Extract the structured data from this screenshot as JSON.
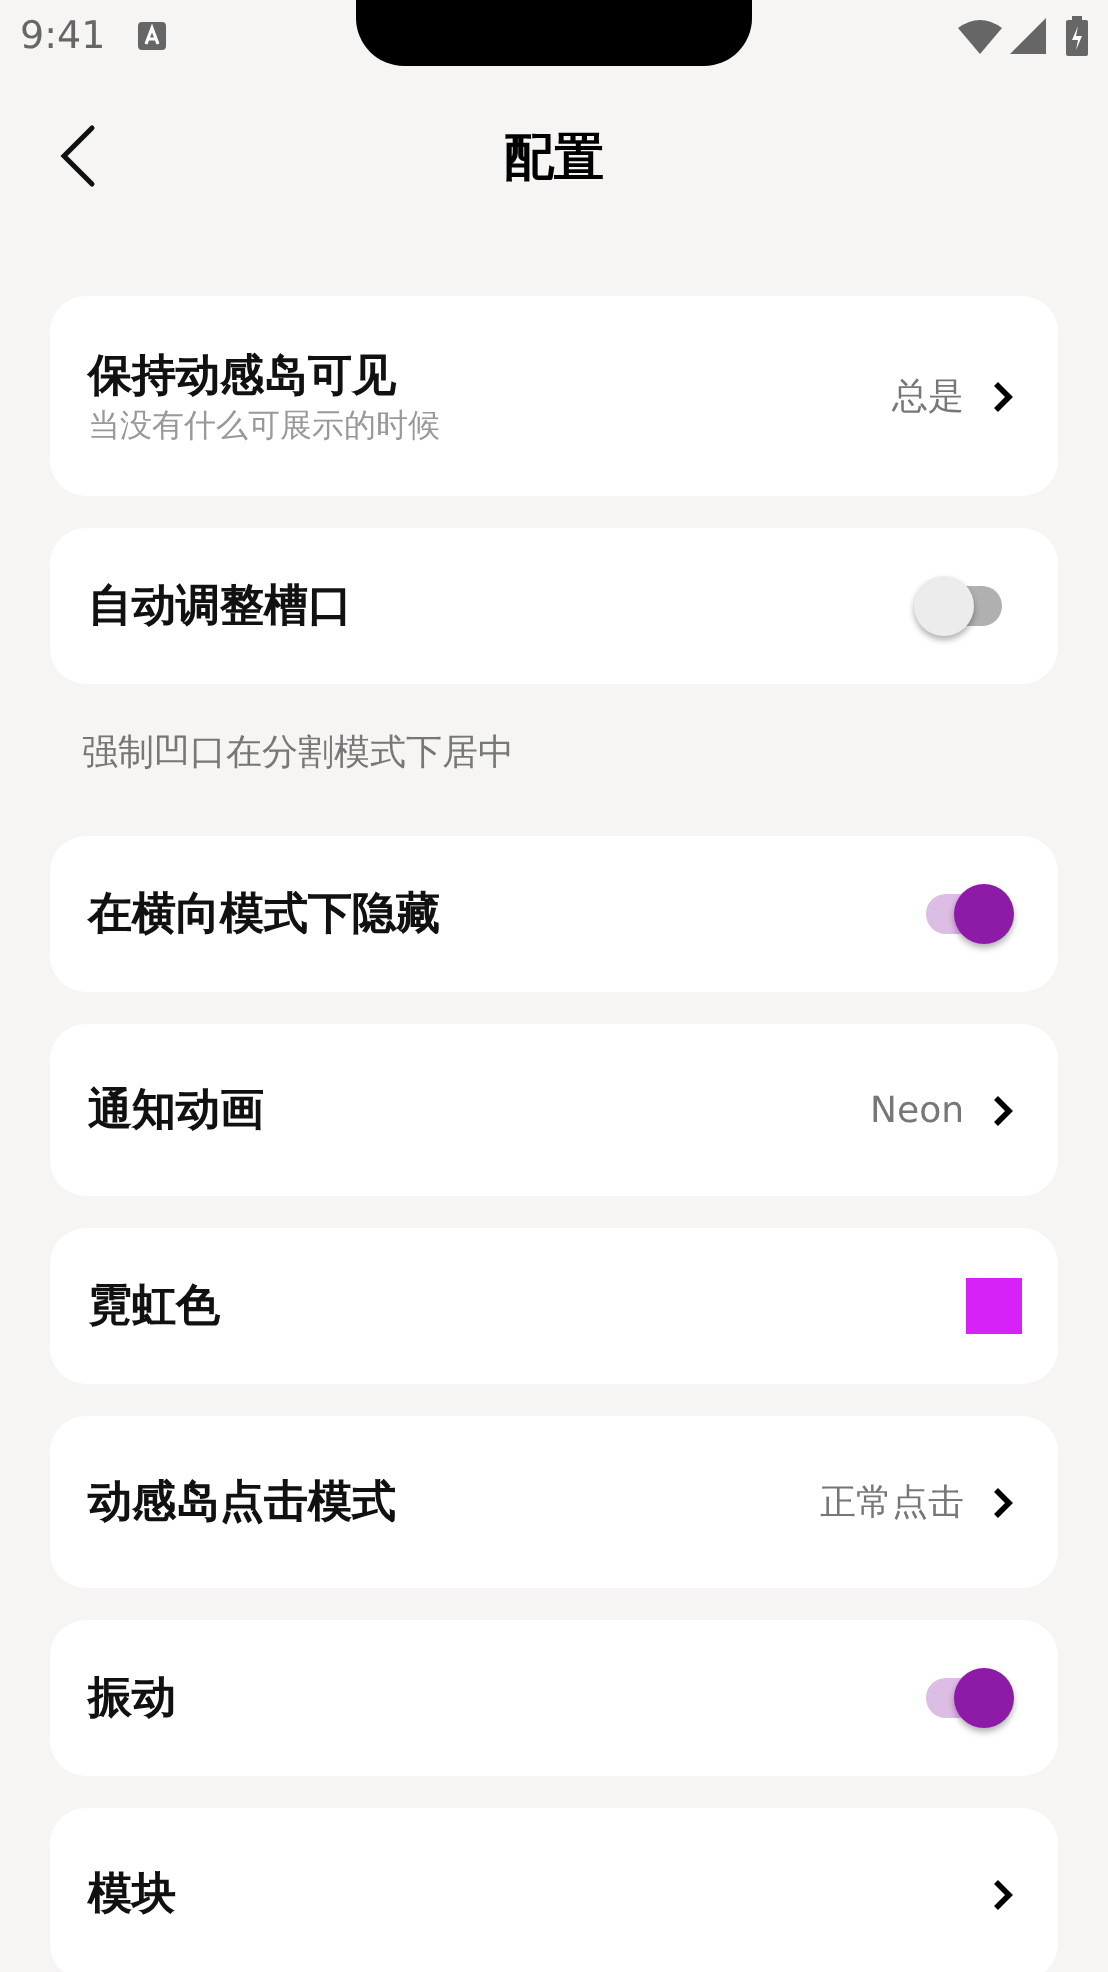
{
  "status_bar": {
    "time": "9:41"
  },
  "header": {
    "title": "配置"
  },
  "settings": [
    {
      "kind": "nav",
      "label": "保持动感岛可见",
      "subtitle": "当没有什么可展示的时候",
      "value": "总是"
    },
    {
      "kind": "switch",
      "label": "自动调整槽口",
      "on": false,
      "note": "强制凹口在分割模式下居中"
    },
    {
      "kind": "switch",
      "label": "在横向模式下隐藏",
      "on": true
    },
    {
      "kind": "nav",
      "label": "通知动画",
      "value": "Neon"
    },
    {
      "kind": "color",
      "label": "霓虹色",
      "color": "#d722f7"
    },
    {
      "kind": "nav",
      "label": "动感岛点击模式",
      "value": "正常点击"
    },
    {
      "kind": "switch",
      "label": "振动",
      "on": true
    },
    {
      "kind": "nav",
      "label": "模块"
    }
  ]
}
